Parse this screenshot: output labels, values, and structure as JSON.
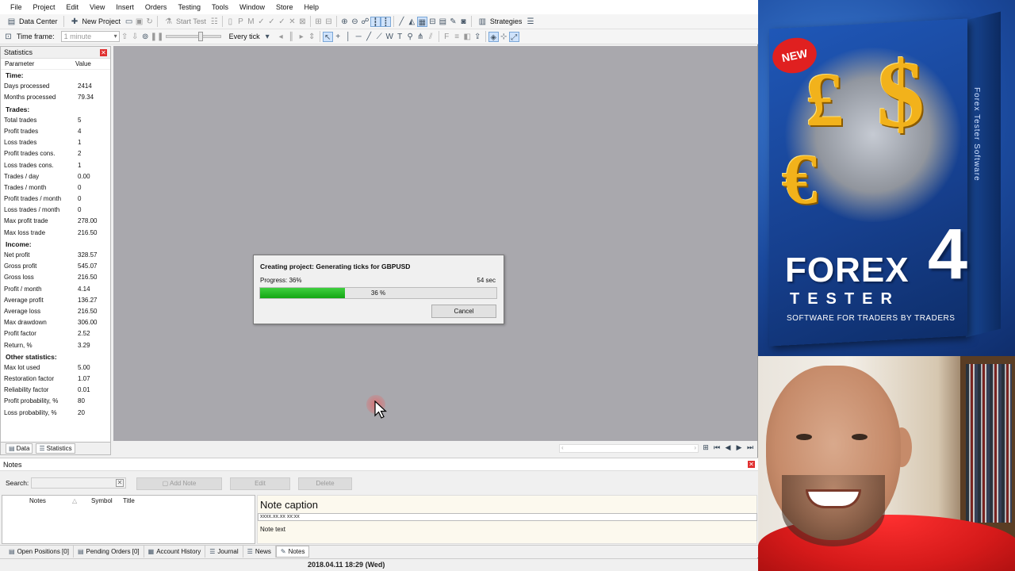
{
  "menu": [
    "File",
    "Project",
    "Edit",
    "View",
    "Insert",
    "Orders",
    "Testing",
    "Tools",
    "Window",
    "Store",
    "Help"
  ],
  "toolbar": {
    "data_center": "Data Center",
    "new_project": "New Project",
    "start_test": "Start Test",
    "strategies": "Strategies",
    "timeframe_label": "Time frame:",
    "timeframe_value": "1 minute",
    "tick_mode": "Every tick"
  },
  "statistics": {
    "title": "Statistics",
    "col_param": "Parameter",
    "col_value": "Value",
    "rows": [
      {
        "p": "Time:",
        "v": "",
        "section": true
      },
      {
        "p": "Days processed",
        "v": "2414"
      },
      {
        "p": "Months processed",
        "v": "79.34"
      },
      {
        "p": "Trades:",
        "v": "",
        "section": true
      },
      {
        "p": "Total trades",
        "v": "5"
      },
      {
        "p": "Profit trades",
        "v": "4"
      },
      {
        "p": "Loss trades",
        "v": "1"
      },
      {
        "p": "Profit trades cons.",
        "v": "2"
      },
      {
        "p": "Loss trades cons.",
        "v": "1"
      },
      {
        "p": "Trades / day",
        "v": "0.00"
      },
      {
        "p": "Trades / month",
        "v": "0"
      },
      {
        "p": "Profit trades / month",
        "v": "0"
      },
      {
        "p": "Loss trades / month",
        "v": "0"
      },
      {
        "p": "Max profit trade",
        "v": "278.00"
      },
      {
        "p": "Max loss trade",
        "v": "216.50"
      },
      {
        "p": "Income:",
        "v": "",
        "section": true
      },
      {
        "p": "Net profit",
        "v": "328.57"
      },
      {
        "p": "Gross profit",
        "v": "545.07"
      },
      {
        "p": "Gross loss",
        "v": "216.50"
      },
      {
        "p": "Profit / month",
        "v": "4.14"
      },
      {
        "p": "Average profit",
        "v": "136.27"
      },
      {
        "p": "Average loss",
        "v": "216.50"
      },
      {
        "p": "Max drawdown",
        "v": "306.00"
      },
      {
        "p": "Profit factor",
        "v": "2.52"
      },
      {
        "p": "Return, %",
        "v": "3.29"
      },
      {
        "p": "Other statistics:",
        "v": "",
        "section": true
      },
      {
        "p": "Max lot used",
        "v": "5.00"
      },
      {
        "p": "Restoration factor",
        "v": "1.07"
      },
      {
        "p": "Reliability factor",
        "v": "0.01"
      },
      {
        "p": "Profit probability, %",
        "v": "80"
      },
      {
        "p": "Loss probability, %",
        "v": "20"
      }
    ],
    "tabs": [
      "Data",
      "Statistics"
    ]
  },
  "dialog": {
    "title": "Creating project: Generating ticks for GBPUSD",
    "progress_label": "Progress: 36%",
    "progress_fraction": 0.36,
    "progress_text": "36 %",
    "remaining": "54 sec",
    "cancel": "Cancel"
  },
  "notes": {
    "title": "Notes",
    "search_label": "Search:",
    "search_value": "",
    "add_note": "Add Note",
    "edit": "Edit",
    "delete": "Delete",
    "col_notes": "Notes",
    "col_symbol": "Symbol",
    "col_title": "Title",
    "caption": "Note caption",
    "date_placeholder": "xxxx.xx.xx xx:xx",
    "note_text": "Note text"
  },
  "bottom_tabs": [
    "Open Positions [0]",
    "Pending Orders [0]",
    "Account History",
    "Journal",
    "News",
    "Notes"
  ],
  "status": {
    "datetime": "2018.04.11 18:29 (Wed)"
  },
  "promo": {
    "badge": "NEW",
    "brand": "FOREX",
    "brand_number": "4",
    "subtitle": "TESTER",
    "slogan": "SOFTWARE FOR TRADERS BY TRADERS",
    "side_text": "Forex Tester Software"
  },
  "colors": {
    "chart_bg": "#a9a8ad",
    "progress_green": "#22b422",
    "close_red": "#e03030",
    "promo_blue": "#1b4a9e",
    "currency_gold": "#f2b21b",
    "shirt_red": "#d51a1a"
  }
}
